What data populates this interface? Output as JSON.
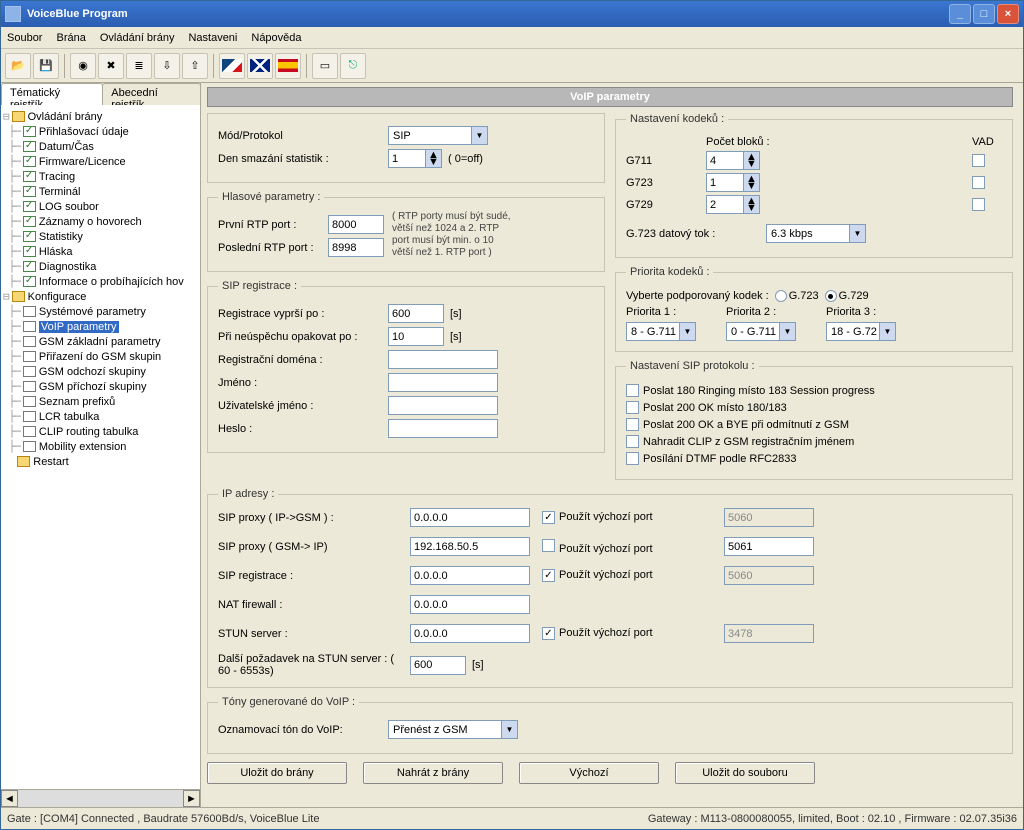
{
  "window": {
    "title": "VoiceBlue Program"
  },
  "menu": {
    "items": [
      "Soubor",
      "Brána",
      "Ovládání brány",
      "Nastaveni",
      "Nápověda"
    ]
  },
  "tabs": {
    "left": "Tématický rejstřík",
    "right": "Abecední rejstřík"
  },
  "tree": {
    "ovladani": {
      "label": "Ovládání brány",
      "items": [
        "Přihlašovací údaje",
        "Datum/Čas",
        "Firmware/Licence",
        "Tracing",
        "Terminál",
        "LOG soubor",
        "Záznamy o hovorech",
        "Statistiky",
        "Hláska",
        "Diagnostika",
        "Informace o probíhajících hov"
      ]
    },
    "konfig": {
      "label": "Konfigurace",
      "items": [
        "Systémové parametry",
        "VoIP parametry",
        "GSM základní parametry",
        "Přiřazení do GSM skupin",
        "GSM odchozí skupiny",
        "GSM příchozí skupiny",
        "Seznam prefixů",
        "LCR tabulka",
        "CLIP routing tabulka",
        "Mobility extension"
      ]
    },
    "restart": "Restart"
  },
  "banner": "VoIP parametry",
  "top": {
    "mode_label": "Mód/Protokol",
    "mode_value": "SIP",
    "day_label": "Den smazání statistik :",
    "day_value": "1",
    "day_hint": "( 0=off)"
  },
  "voice": {
    "legend": "Hlasové parametry :",
    "first_label": "První RTP port :",
    "first_value": "8000",
    "last_label": "Poslední RTP port :",
    "last_value": "8998",
    "hint": "( RTP porty musí být sudé, větší než 1024 a 2. RTP port musí být min. o 10 větší než 1. RTP port )"
  },
  "codec": {
    "legend": "Nastavení kodeků :",
    "blocks": "Počet bloků :",
    "vad": "VAD",
    "g711": "G711",
    "g711_v": "4",
    "g723": "G723",
    "g723_v": "1",
    "g729": "G729",
    "g729_v": "2",
    "bitrate_label": "G.723 datový tok :",
    "bitrate_value": "6.3 kbps"
  },
  "prio": {
    "legend": "Priorita kodeků :",
    "support": "Vyberte podporovaný kodek :",
    "g723": "G.723",
    "g729": "G.729",
    "p1": "Priorita 1 :",
    "p2": "Priorita 2 :",
    "p3": "Priorita 3 :",
    "v1": "8 - G.711",
    "v2": "0 - G.711",
    "v3": "18 - G.72"
  },
  "sipreg": {
    "legend": "SIP registrace :",
    "expire_label": "Registrace vyprší po :",
    "expire_value": "600",
    "unit": "[s]",
    "retry_label": "Při neúspěchu opakovat po :",
    "retry_value": "10",
    "domain_label": "Registrační doména :",
    "name_label": "Jméno :",
    "user_label": "Uživatelské jméno :",
    "pass_label": "Heslo :"
  },
  "sipset": {
    "legend": "Nastavení SIP protokolu :",
    "o1": "Poslat 180 Ringing místo 183 Session progress",
    "o2": "Poslat 200 OK místo 180/183",
    "o3": "Poslat 200 OK a BYE při odmítnutí z GSM",
    "o4": "Nahradit CLIP z GSM registračním jménem",
    "o5": "Posílání DTMF podle RFC2833"
  },
  "ip": {
    "legend": "IP adresy :",
    "proxy1": "SIP proxy ( IP->GSM ) :",
    "proxy1_v": "0.0.0.0",
    "useport": "Použít výchozí port",
    "port1": "5060",
    "proxy2": "SIP proxy ( GSM-> IP)",
    "proxy2_v": "192.168.50.5",
    "port2": "5061",
    "reg": "SIP registrace :",
    "reg_v": "0.0.0.0",
    "port3": "5060",
    "nat": "NAT firewall :",
    "nat_v": "0.0.0.0",
    "stun": "STUN server :",
    "stun_v": "0.0.0.0",
    "port5": "3478",
    "stunnext": "Další požadavek na STUN server : ( 60 - 6553s)",
    "stunnext_v": "600",
    "unit": "[s]"
  },
  "tones": {
    "legend": "Tóny generované do VoIP :",
    "label": "Oznamovací tón do VoIP:",
    "value": "Přenést z GSM"
  },
  "buttons": {
    "b1": "Uložit do brány",
    "b2": "Nahrát z brány",
    "b3": "Výchozí",
    "b4": "Uložit do souboru"
  },
  "status": {
    "left": "Gate : [COM4] Connected , Baudrate 57600Bd/s, VoiceBlue Lite",
    "right": "Gateway : M113-0800080055, limited, Boot : 02.10 , Firmware : 02.07.35i36"
  }
}
